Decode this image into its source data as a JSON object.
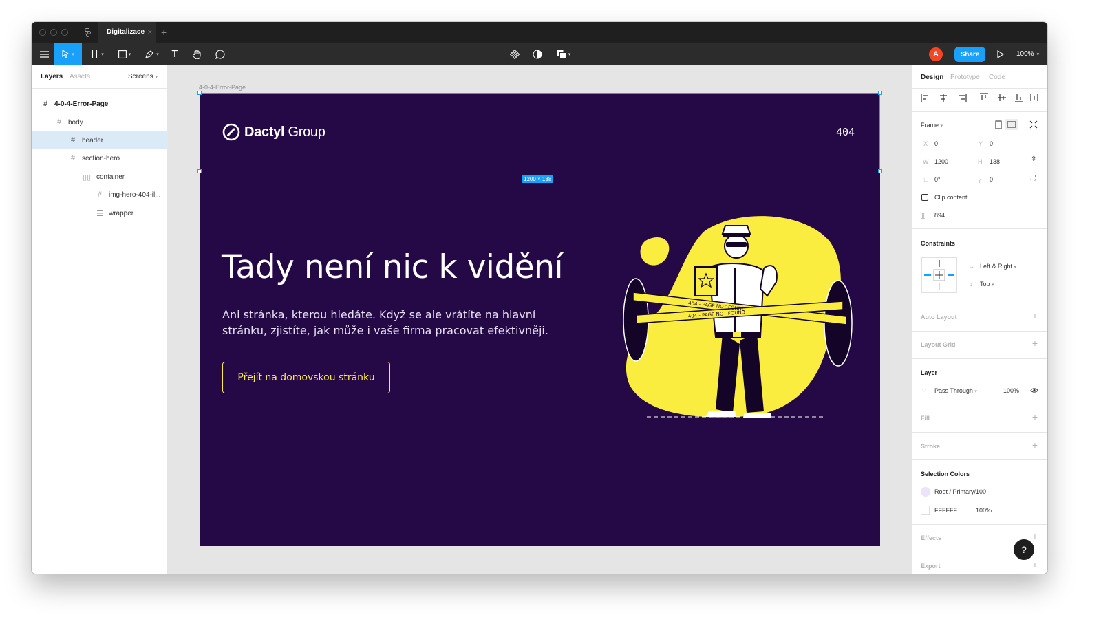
{
  "window": {
    "tab_title": "Digitalizace",
    "tab_close": "×",
    "tab_add": "+"
  },
  "toolbar": {
    "icons": [
      "menu-icon",
      "move-tool-icon",
      "frame-tool-icon",
      "shape-tool-icon",
      "pen-tool-icon",
      "text-tool-icon",
      "hand-tool-icon",
      "comment-icon",
      "component-icon",
      "mask-icon",
      "boolean-icon",
      "present-icon"
    ],
    "avatar_initial": "A",
    "share_label": "Share",
    "zoom_label": "100%"
  },
  "left_panel": {
    "tabs": [
      "Layers",
      "Assets"
    ],
    "page_selector": "Screens",
    "layers": [
      {
        "name": "4-0-4-Error-Page",
        "icon": "frame-icon"
      },
      {
        "name": "body",
        "icon": "frame-icon"
      },
      {
        "name": "header",
        "icon": "frame-icon",
        "selected": true
      },
      {
        "name": "section-hero",
        "icon": "frame-icon"
      },
      {
        "name": "container",
        "icon": "columns-icon"
      },
      {
        "name": "img-hero-404-il...",
        "icon": "frame-icon"
      },
      {
        "name": "wrapper",
        "icon": "rows-icon"
      }
    ]
  },
  "canvas": {
    "frame_label": "4-0-4-Error-Page",
    "selection_size": "1200 × 138",
    "page": {
      "logo_bold": "Dactyl",
      "logo_light": " Group",
      "error_code": "404",
      "hero_title": "Tady není nic k vidění",
      "hero_text": "Ani stránka, kterou hledáte. Když se ale vrátíte na hlavní stránku, zjistíte, jak může i vaše firma pracovat efektivněji.",
      "hero_button": "Přejít na domovskou stránku",
      "tape_text": "404 - PAGE NOT FOUND"
    },
    "colors": {
      "page_bg": "#240946",
      "accent": "#fbed3f",
      "selection": "#18a0fb"
    }
  },
  "right_panel": {
    "tabs": [
      "Design",
      "Prototype",
      "Code"
    ],
    "frame_section": "Frame",
    "x_label": "X",
    "x_value": "0",
    "y_label": "Y",
    "y_value": "0",
    "w_label": "W",
    "w_value": "1200",
    "h_label": "H",
    "h_value": "138",
    "rotation_value": "0°",
    "radius_value": "0",
    "clip_content_label": "Clip content",
    "spacing_value": "894",
    "constraints_title": "Constraints",
    "constraint_h": "Left & Right",
    "constraint_v": "Top",
    "auto_layout": "Auto Layout",
    "layout_grid": "Layout Grid",
    "layer_title": "Layer",
    "blend_mode": "Pass Through",
    "layer_opacity": "100%",
    "fill": "Fill",
    "stroke": "Stroke",
    "selection_colors_title": "Selection Colors",
    "selection_colors": [
      {
        "name": "Root / Primary/100",
        "swatch": "#ece4fb",
        "opacity": ""
      },
      {
        "name": "FFFFFF",
        "swatch": "#ffffff",
        "opacity": "100%"
      }
    ],
    "effects": "Effects",
    "export": "Export"
  },
  "help_label": "?"
}
